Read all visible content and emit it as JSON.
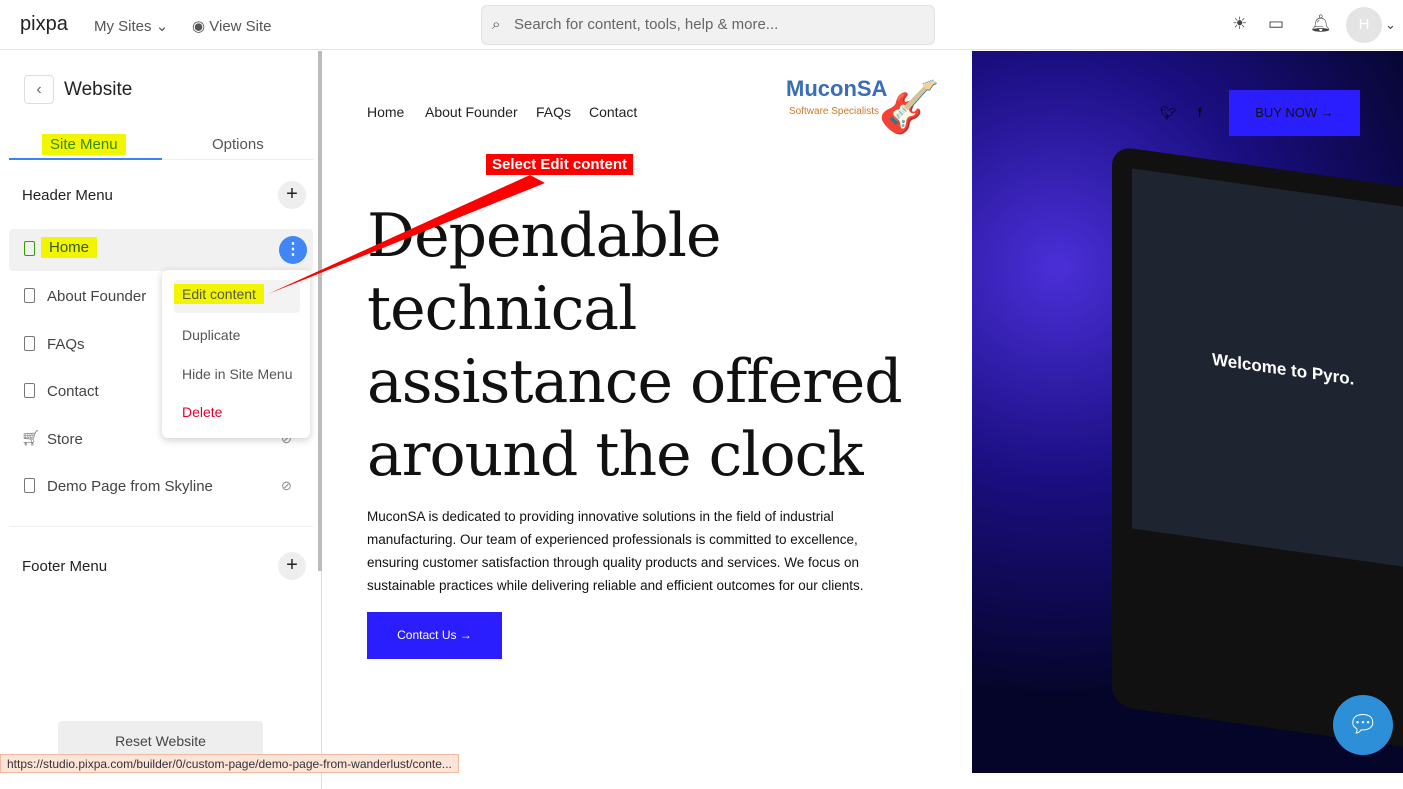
{
  "topbar": {
    "logo": "pixpa",
    "my_sites": "My Sites",
    "view_site": "View Site",
    "search_placeholder": "Search for content, tools, help & more...",
    "avatar": "H"
  },
  "sidebar": {
    "title": "Website",
    "tabs": [
      {
        "label": "Site Menu"
      },
      {
        "label": "Options"
      }
    ],
    "header_menu": "Header Menu",
    "footer_menu": "Footer Menu",
    "items": [
      {
        "label": "Home"
      },
      {
        "label": "About Founder"
      },
      {
        "label": "FAQs"
      },
      {
        "label": "Contact"
      },
      {
        "label": "Store"
      },
      {
        "label": "Demo Page from Skyline"
      }
    ],
    "context_menu": [
      "Edit content",
      "Duplicate",
      "Hide in Site Menu",
      "Delete"
    ],
    "reset": "Reset Website"
  },
  "status_url": "https://studio.pixpa.com/builder/0/custom-page/demo-page-from-wanderlust/conte...",
  "annotation": "Select Edit content",
  "site": {
    "nav": [
      "Home",
      "About Founder",
      "FAQs",
      "Contact"
    ],
    "brand": "MuconSA",
    "tagline": "Software Specialists",
    "hero": "Dependable technical assistance offered around the clock",
    "description": "MuconSA is dedicated to providing innovative solutions in the field of industrial manufacturing. Our team of experienced professionals is committed to excellence, ensuring customer satisfaction through quality products and services. We focus on sustainable practices while delivering reliable and efficient outcomes for our clients.",
    "contact_btn": "Contact Us →",
    "buy_now": "BUY NOW →",
    "screen_text": "Welcome to Pyro."
  },
  "colors": {
    "accent": "#2a1eff",
    "highlight": "#f2f500",
    "tab": "#3b82f6",
    "delete": "#e0002a"
  }
}
